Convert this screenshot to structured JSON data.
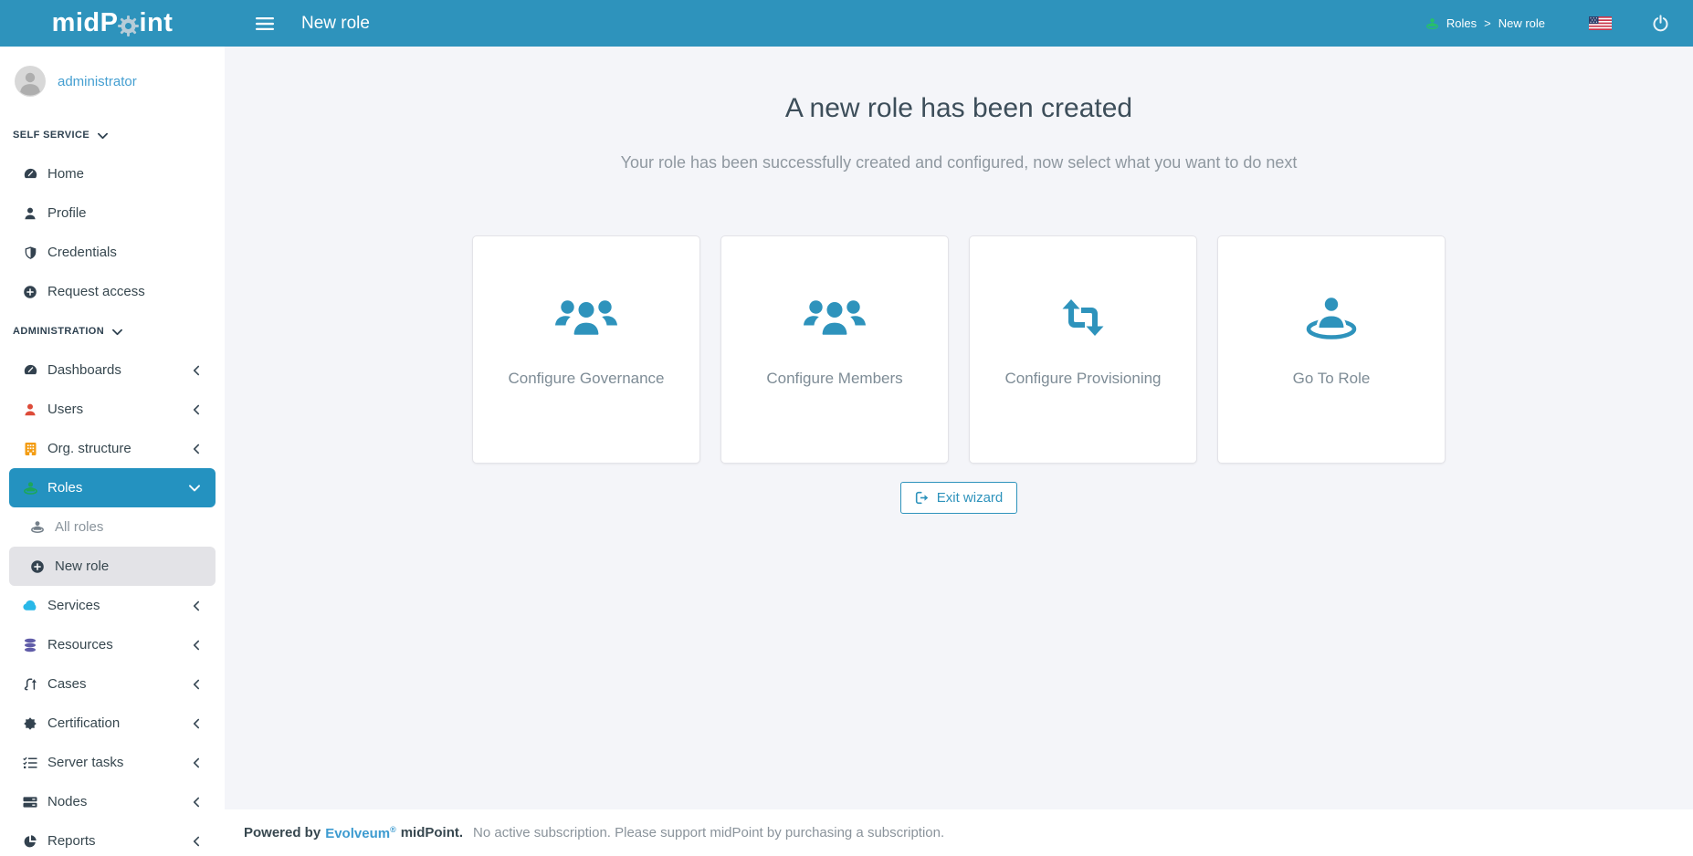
{
  "topbar": {
    "logo_pre": "midP",
    "logo_post": "int",
    "page_title": "New role",
    "breadcrumb": {
      "parent": "Roles",
      "separator": ">",
      "current": "New role"
    }
  },
  "sidebar": {
    "user": {
      "name": "administrator"
    },
    "sections": [
      {
        "label": "SELF SERVICE",
        "items": [
          {
            "label": "Home",
            "icon": "tachometer-icon"
          },
          {
            "label": "Profile",
            "icon": "user-icon"
          },
          {
            "label": "Credentials",
            "icon": "shield-icon"
          },
          {
            "label": "Request access",
            "icon": "plus-circle-icon"
          }
        ]
      },
      {
        "label": "ADMINISTRATION",
        "items": [
          {
            "label": "Dashboards",
            "icon": "tachometer-icon"
          },
          {
            "label": "Users",
            "icon": "user-icon"
          },
          {
            "label": "Org. structure",
            "icon": "building-icon"
          },
          {
            "label": "Roles",
            "icon": "role-icon",
            "state": "expanded-selected"
          },
          {
            "label": "All roles",
            "icon": "role-icon",
            "submenu": true
          },
          {
            "label": "New role",
            "icon": "plus-circle-icon",
            "submenu": true,
            "state": "current"
          },
          {
            "label": "Services",
            "icon": "cloud-icon"
          },
          {
            "label": "Resources",
            "icon": "database-icon"
          },
          {
            "label": "Cases",
            "icon": "route-icon"
          },
          {
            "label": "Certification",
            "icon": "seal-icon"
          },
          {
            "label": "Server tasks",
            "icon": "tasks-icon"
          },
          {
            "label": "Nodes",
            "icon": "server-icon"
          },
          {
            "label": "Reports",
            "icon": "pie-chart-icon"
          }
        ]
      }
    ]
  },
  "main": {
    "heading": "A new role has been created",
    "subheading": "Your role has been successfully created and configured, now select what you want to do next",
    "tiles": [
      {
        "label": "Configure Governance",
        "icon": "users-group-icon"
      },
      {
        "label": "Configure Members",
        "icon": "users-group-icon"
      },
      {
        "label": "Configure Provisioning",
        "icon": "repeat-icon"
      },
      {
        "label": "Go To Role",
        "icon": "role-icon"
      }
    ],
    "exit_label": "Exit wizard"
  },
  "footer": {
    "powered_by": "Powered by",
    "brand": "Evolveum",
    "reg": "®",
    "product": "midPoint.",
    "message": "No active subscription. Please support midPoint by purchasing a subscription."
  },
  "colors": {
    "topbar": "#2e93bc",
    "selected_item": "#2492c0",
    "link": "#459fd1",
    "tile_icon": "#2e93bc",
    "users_red": "#dd4b39",
    "org_orange": "#f39c12",
    "roles_green": "#1ca65b",
    "services_blue": "#29b8e8",
    "resources_purple": "#605ca8",
    "breadcrumb_role_green": "#27c06a"
  }
}
